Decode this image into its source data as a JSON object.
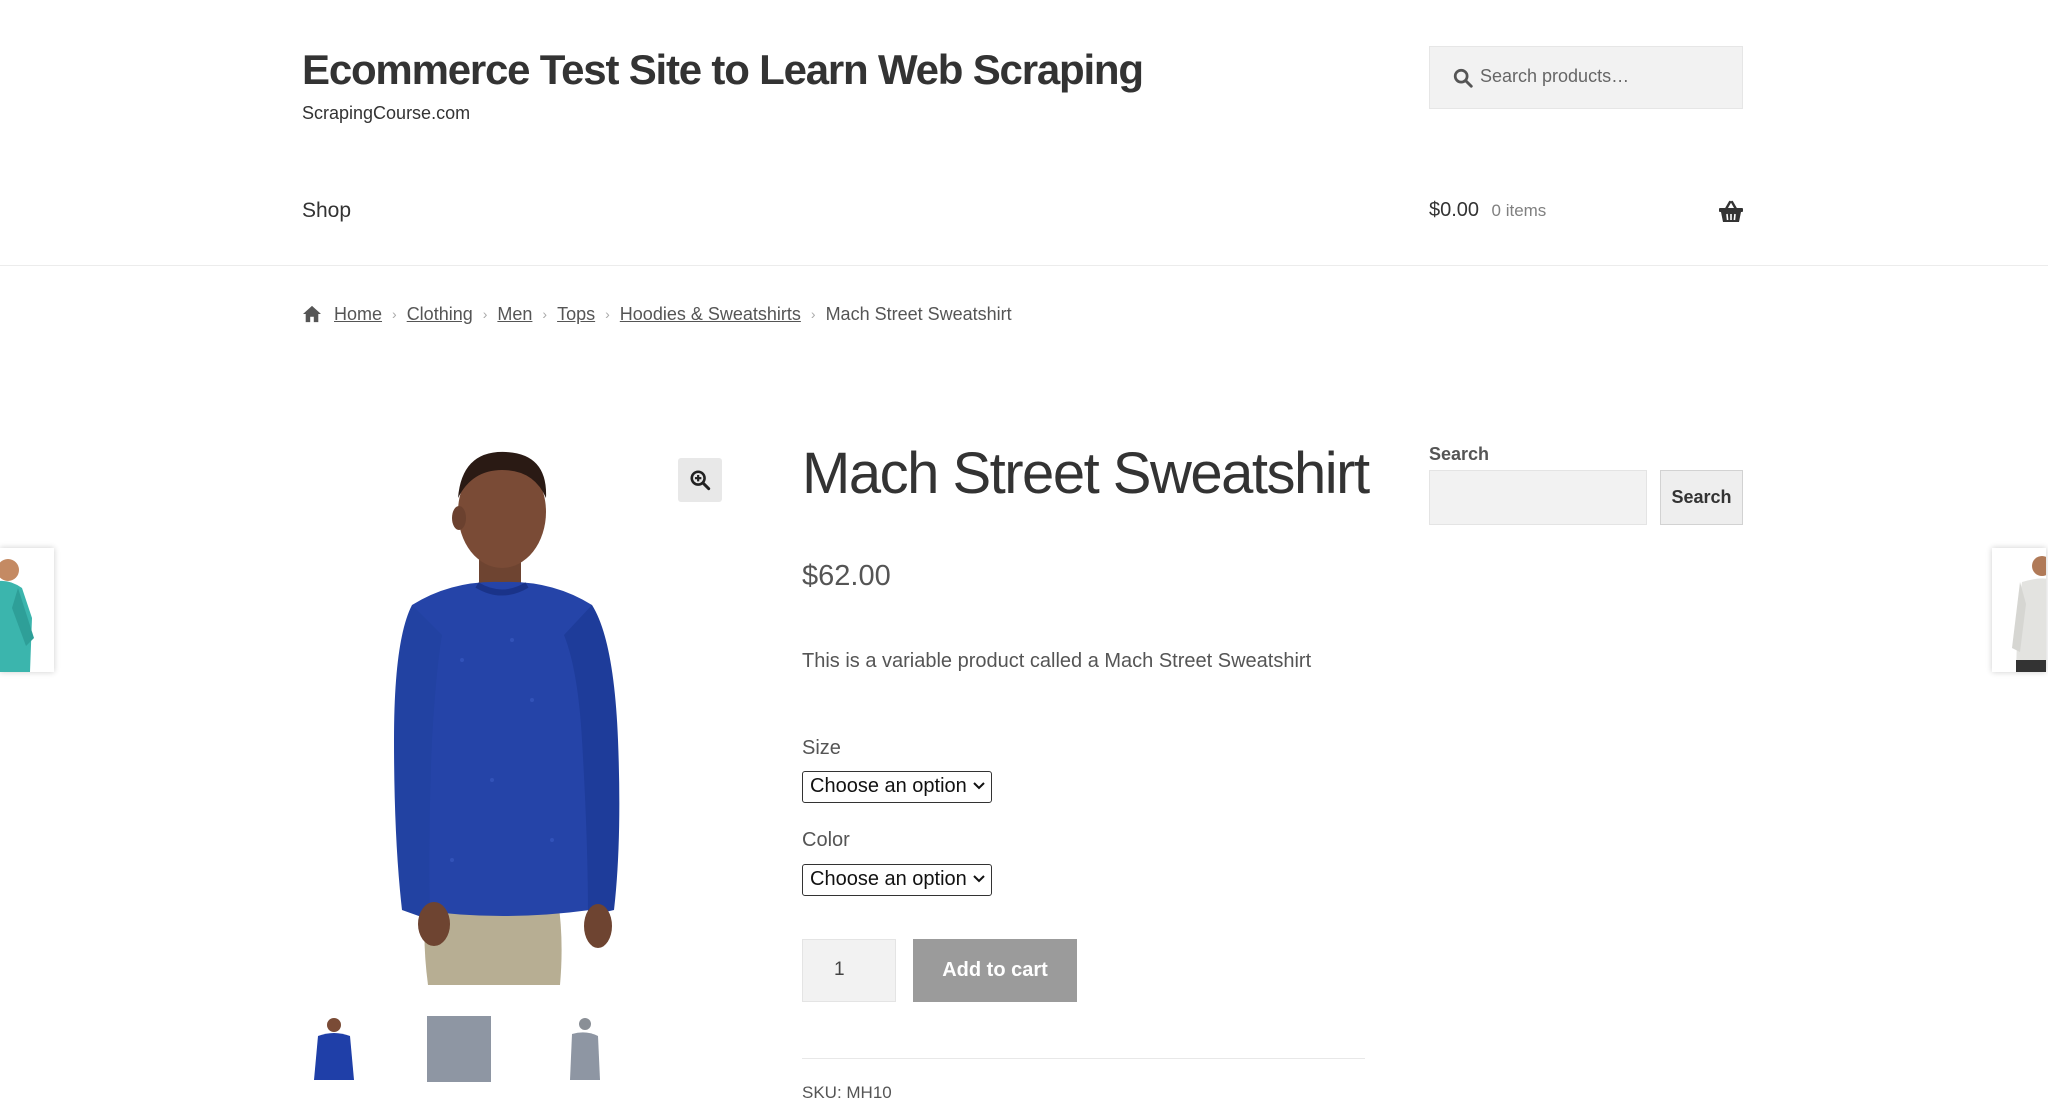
{
  "header": {
    "site_title": "Ecommerce Test Site to Learn Web Scraping",
    "site_description": "ScrapingCourse.com",
    "search_placeholder": "Search products…"
  },
  "nav": {
    "items": [
      {
        "label": "Shop"
      }
    ]
  },
  "cart": {
    "amount": "$0.00",
    "count": "0 items"
  },
  "breadcrumb": {
    "items": [
      "Home",
      "Clothing",
      "Men",
      "Tops",
      "Hoodies & Sweatshirts"
    ],
    "current": "Mach Street Sweatshirt"
  },
  "product": {
    "title": "Mach Street Sweatshirt",
    "price": "$62.00",
    "description": "This is a variable product called a Mach Street Sweatshirt",
    "size_label": "Size",
    "size_value": "Choose an option",
    "color_label": "Color",
    "color_value": "Choose an option",
    "quantity": "1",
    "add_to_cart": "Add to cart",
    "sku": "SKU: MH10",
    "main_color": "#1f3fa8",
    "thumbnails": [
      "blue",
      "gray",
      "gray-side"
    ]
  },
  "sidebar": {
    "widget_title": "Search",
    "button": "Search"
  },
  "icons": {
    "search": "search-icon",
    "basket": "basket-icon",
    "home": "home-icon",
    "zoom": "zoom-icon",
    "chevron": "chevron-down-icon"
  }
}
